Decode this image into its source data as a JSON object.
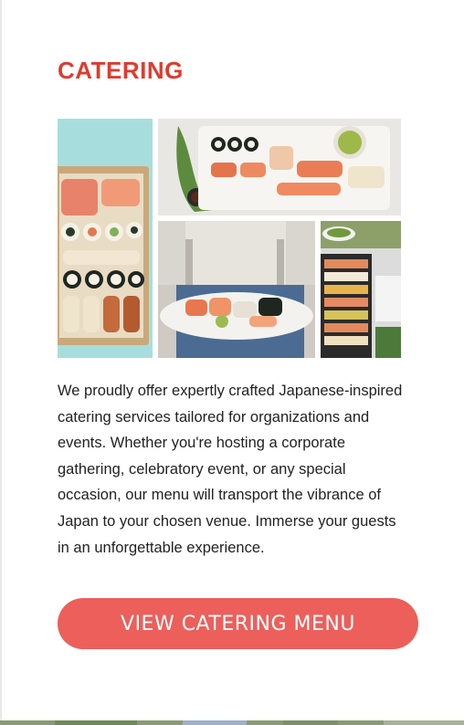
{
  "section": {
    "title": "CATERING",
    "description": "We proudly offer expertly crafted Japanese-inspired catering services tailored for organizations and events. Whether you're hosting a corporate gathering, celebratory event, or any special occasion, our menu will transport the vibrance of Japan to your chosen venue. Immerse your guests in an unforgettable experience."
  },
  "cta": {
    "label": "VIEW CATERING MENU"
  },
  "colors": {
    "accent": "#e03a2f",
    "button": "#ec5f5b",
    "text": "#222222"
  }
}
